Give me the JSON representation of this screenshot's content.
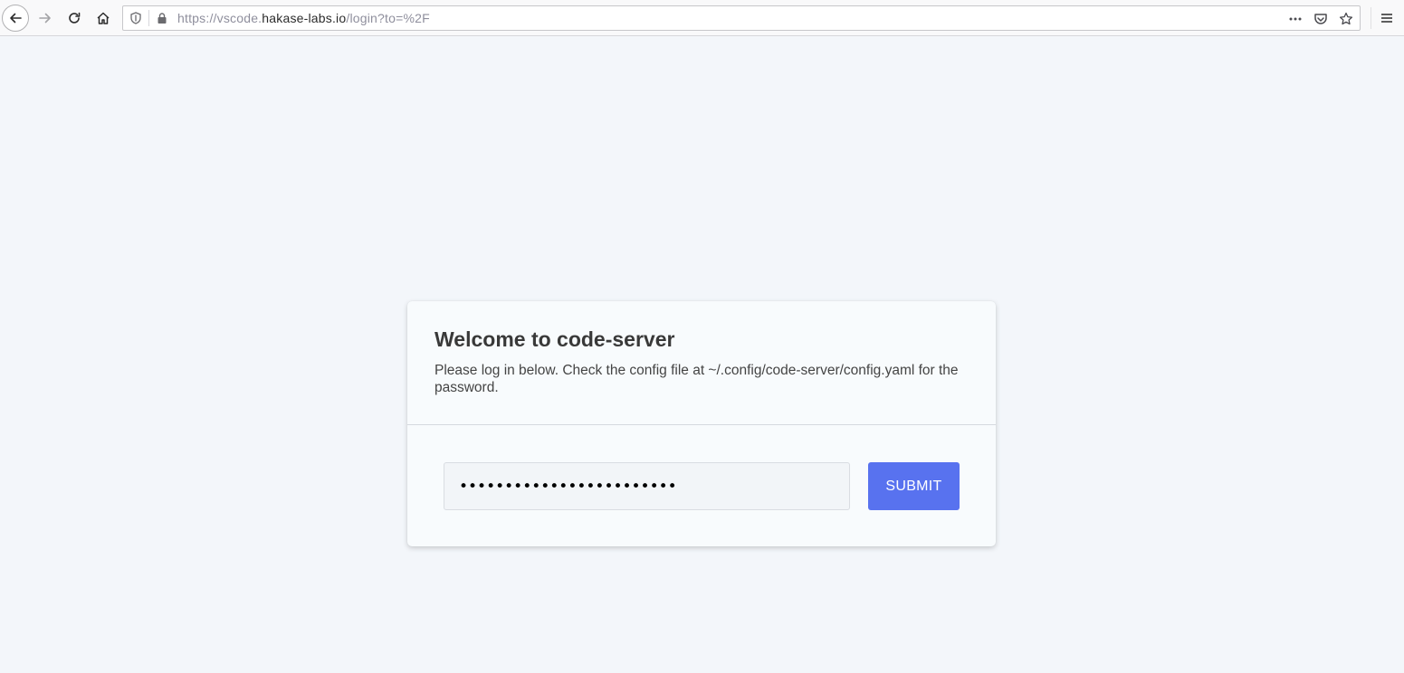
{
  "browser": {
    "url": {
      "scheme": "https://vscode.",
      "host": "hakase-labs.io",
      "path": "/login?to=%2F"
    },
    "icons": {
      "back": "back-arrow-icon",
      "forward": "forward-arrow-icon",
      "reload": "reload-icon",
      "home": "home-icon",
      "shield": "tracking-protection-shield-icon",
      "lock": "lock-icon",
      "page_actions": "more-dots-icon",
      "pocket": "pocket-icon",
      "bookmark": "star-icon",
      "menu": "hamburger-menu-icon"
    }
  },
  "login": {
    "title": "Welcome to code-server",
    "subtitle": "Please log in below. Check the config file at ~/.config/code-server/config.yaml for the password.",
    "password_value": "••••••••••••••••••••••••",
    "submit_label": "SUBMIT"
  },
  "colors": {
    "page_background": "#f3f6fa",
    "card_background": "#f8fbfd",
    "submit_button": "#5872ef"
  }
}
